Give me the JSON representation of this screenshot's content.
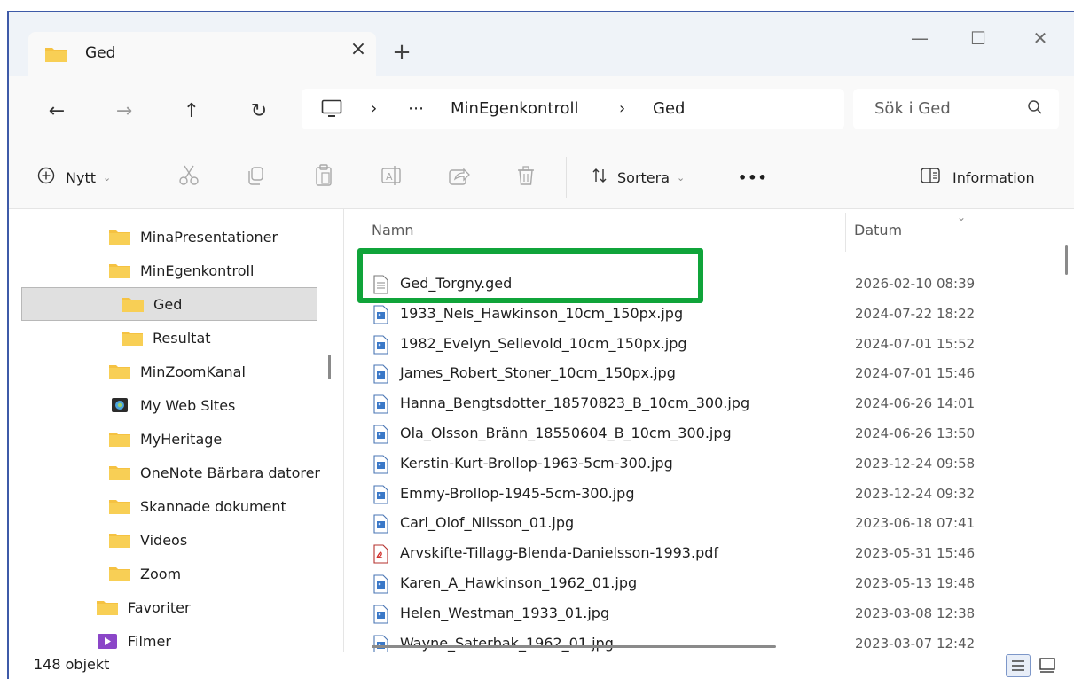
{
  "tab": {
    "title": "Ged",
    "close": "×",
    "new_tab": "+"
  },
  "window_controls": {
    "minimize": "—",
    "maximize": "☐",
    "close": "✕"
  },
  "nav": {
    "back": "←",
    "forward": "→",
    "up": "↑",
    "refresh": "↻"
  },
  "address": {
    "sep1": "›",
    "ellipsis": "⋯",
    "crumb1": "MinEgenkontroll",
    "sep2": "›",
    "crumb2": "Ged"
  },
  "search": {
    "placeholder": "Sök i Ged"
  },
  "commands": {
    "new_label": "Nytt",
    "sort_label": "Sortera",
    "more": "•••",
    "info_label": "Information"
  },
  "sidebar": {
    "items": [
      {
        "label": "MinaPresentationer"
      },
      {
        "label": "MinEgenkontroll"
      },
      {
        "label": "Ged"
      },
      {
        "label": "Resultat"
      },
      {
        "label": "MinZoomKanal"
      },
      {
        "label": "My Web Sites"
      },
      {
        "label": "MyHeritage"
      },
      {
        "label": "OneNote Bärbara datorer"
      },
      {
        "label": "Skannade dokument"
      },
      {
        "label": "Videos"
      },
      {
        "label": "Zoom"
      },
      {
        "label": "Favoriter"
      },
      {
        "label": "Filmer"
      }
    ]
  },
  "files": {
    "columns": {
      "name": "Namn",
      "date": "Datum"
    },
    "rows": [
      {
        "name": "Ged_Torgny.ged",
        "date": "2026-02-10 08:39",
        "type": "ged"
      },
      {
        "name": "1933_Nels_Hawkinson_10cm_150px.jpg",
        "date": "2024-07-22 18:22",
        "type": "jpg"
      },
      {
        "name": "1982_Evelyn_Sellevold_10cm_150px.jpg",
        "date": "2024-07-01 15:52",
        "type": "jpg"
      },
      {
        "name": "James_Robert_Stoner_10cm_150px.jpg",
        "date": "2024-07-01 15:46",
        "type": "jpg"
      },
      {
        "name": "Hanna_Bengtsdotter_18570823_B_10cm_300.jpg",
        "date": "2024-06-26 14:01",
        "type": "jpg"
      },
      {
        "name": "Ola_Olsson_Bränn_18550604_B_10cm_300.jpg",
        "date": "2024-06-26 13:50",
        "type": "jpg"
      },
      {
        "name": "Kerstin-Kurt-Brollop-1963-5cm-300.jpg",
        "date": "2023-12-24 09:58",
        "type": "jpg"
      },
      {
        "name": "Emmy-Brollop-1945-5cm-300.jpg",
        "date": "2023-12-24 09:32",
        "type": "jpg"
      },
      {
        "name": "Carl_Olof_Nilsson_01.jpg",
        "date": "2023-06-18 07:41",
        "type": "jpg"
      },
      {
        "name": "Arvskifte-Tillagg-Blenda-Danielsson-1993.pdf",
        "date": "2023-05-31 15:46",
        "type": "pdf"
      },
      {
        "name": "Karen_A_Hawkinson_1962_01.jpg",
        "date": "2023-05-13 19:48",
        "type": "jpg"
      },
      {
        "name": "Helen_Westman_1933_01.jpg",
        "date": "2023-03-08 12:38",
        "type": "jpg"
      },
      {
        "name": "Wayne_Saterbak_1962_01.jpg",
        "date": "2023-03-07 12:42",
        "type": "jpg"
      }
    ]
  },
  "status": {
    "count": "148 objekt"
  },
  "colors": {
    "highlight": "#10a43a",
    "folder": "#f5c242",
    "frame": "#3e5aa8"
  }
}
